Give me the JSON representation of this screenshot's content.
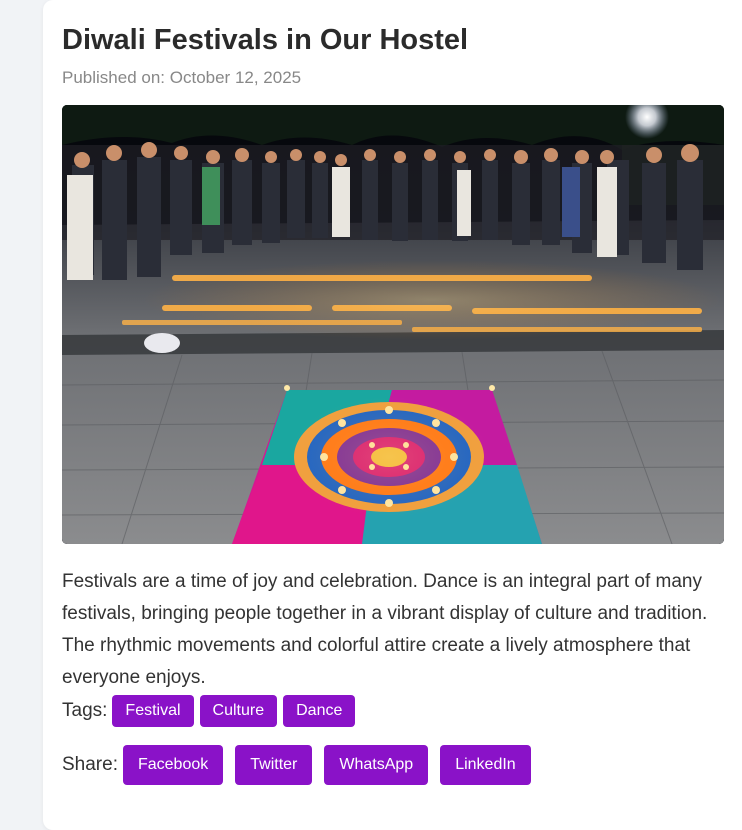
{
  "post": {
    "title": "Diwali Festivals in Our Hostel",
    "published": "Published on: October 12, 2025",
    "image_alt": "Students gathered around rangoli and diyas at night",
    "body": "Festivals are a time of joy and celebration. Dance is an integral part of many festivals, bringing people together in a vibrant display of culture and tradition. The rhythmic movements and colorful attire create a lively atmosphere that everyone enjoys."
  },
  "tags": {
    "label": "Tags:",
    "items": [
      "Festival",
      "Culture",
      "Dance"
    ]
  },
  "share": {
    "label": "Share:",
    "buttons": [
      "Facebook",
      "Twitter",
      "WhatsApp",
      "LinkedIn"
    ]
  },
  "colors": {
    "accent": "#8a12c8",
    "page_bg": "#f1f3f6",
    "card_bg": "#ffffff",
    "title_text": "#2b2b2b",
    "meta_text": "#888888"
  }
}
